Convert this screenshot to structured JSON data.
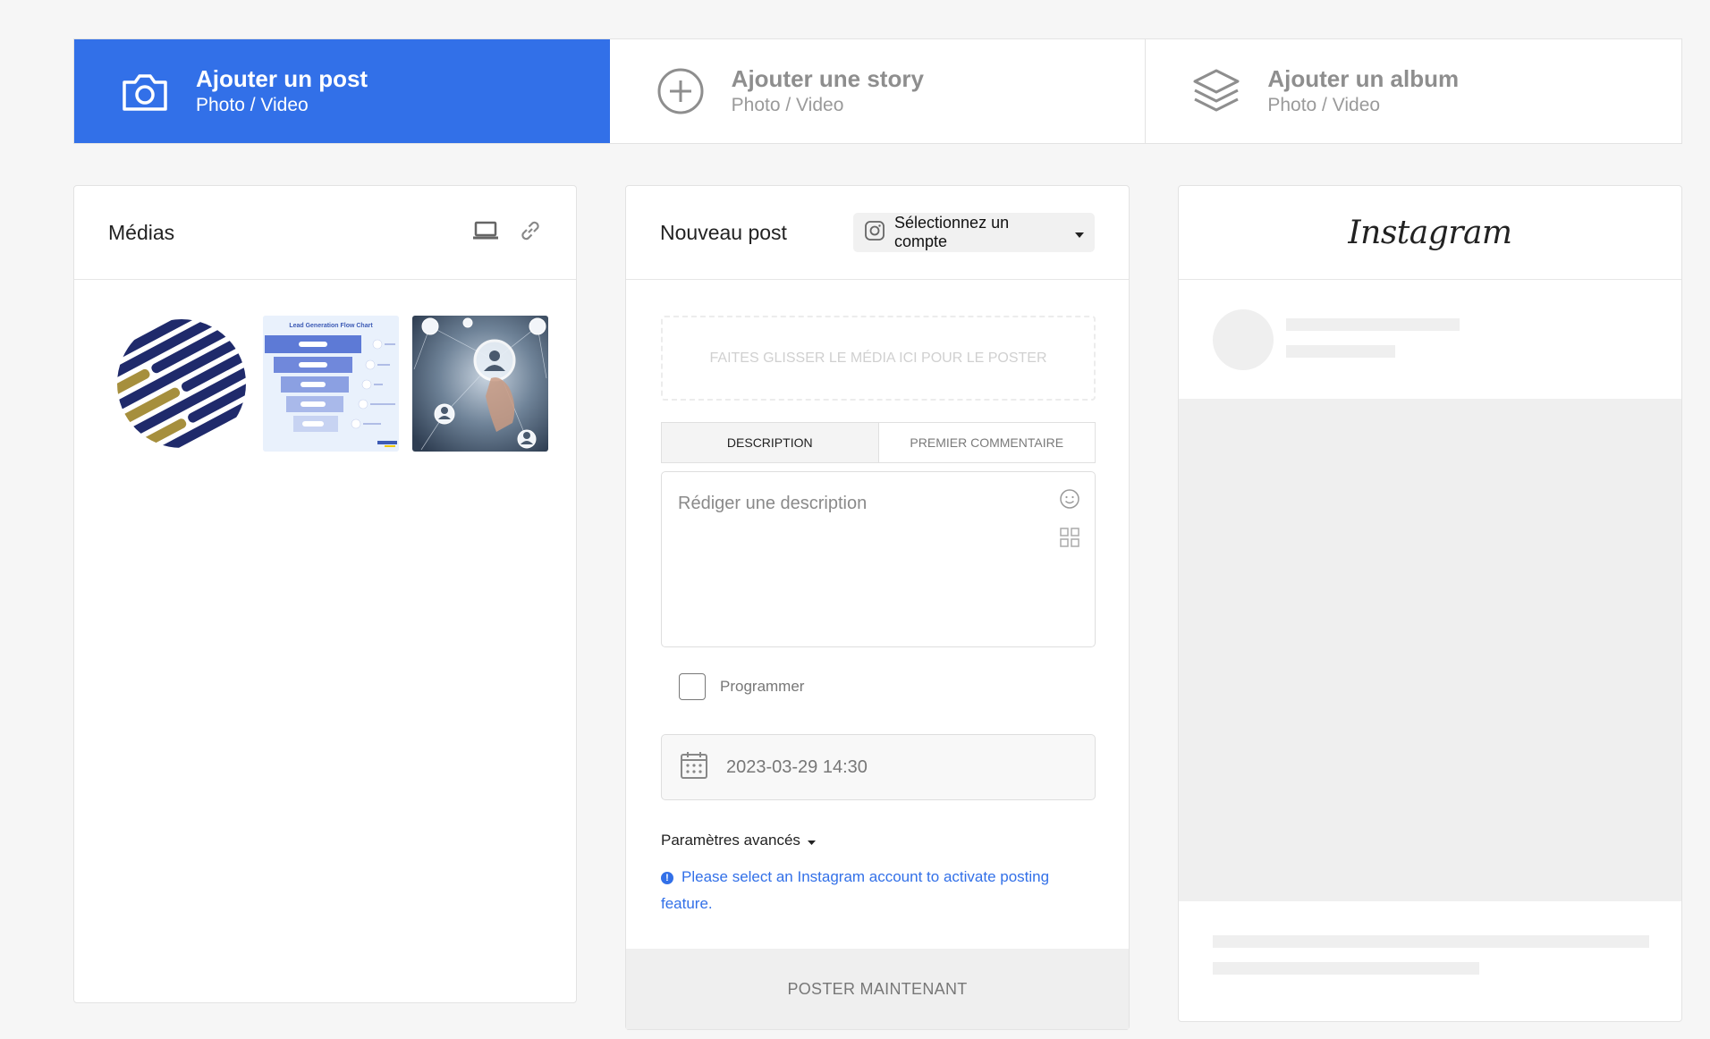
{
  "tabs": [
    {
      "title": "Ajouter un post",
      "subtitle": "Photo / Video",
      "icon": "camera-icon",
      "active": true
    },
    {
      "title": "Ajouter une story",
      "subtitle": "Photo / Video",
      "icon": "plus-circle-icon",
      "active": false
    },
    {
      "title": "Ajouter un album",
      "subtitle": "Photo / Video",
      "icon": "layers-icon",
      "active": false
    }
  ],
  "media": {
    "title": "Médias",
    "icons": [
      "laptop-icon",
      "link-icon"
    ],
    "thumb_flowchart_title": "Lead Generation Flow Chart"
  },
  "post": {
    "title": "Nouveau post",
    "account_select": "Sélectionnez un compte",
    "drop_zone": "FAITES GLISSER LE MÉDIA ICI POUR LE POSTER",
    "tab_description": "DESCRIPTION",
    "tab_first_comment": "PREMIER COMMENTAIRE",
    "description_placeholder": "Rédiger une description",
    "schedule_label": "Programmer",
    "datetime": "2023-03-29 14:30",
    "advanced": "Paramètres avancés",
    "warning": "Please select an Instagram account to activate posting feature.",
    "submit": "POSTER MAINTENANT"
  },
  "preview": {
    "logo": "Instagram"
  },
  "colors": {
    "accent": "#3270e8",
    "background": "#f6f6f6"
  }
}
